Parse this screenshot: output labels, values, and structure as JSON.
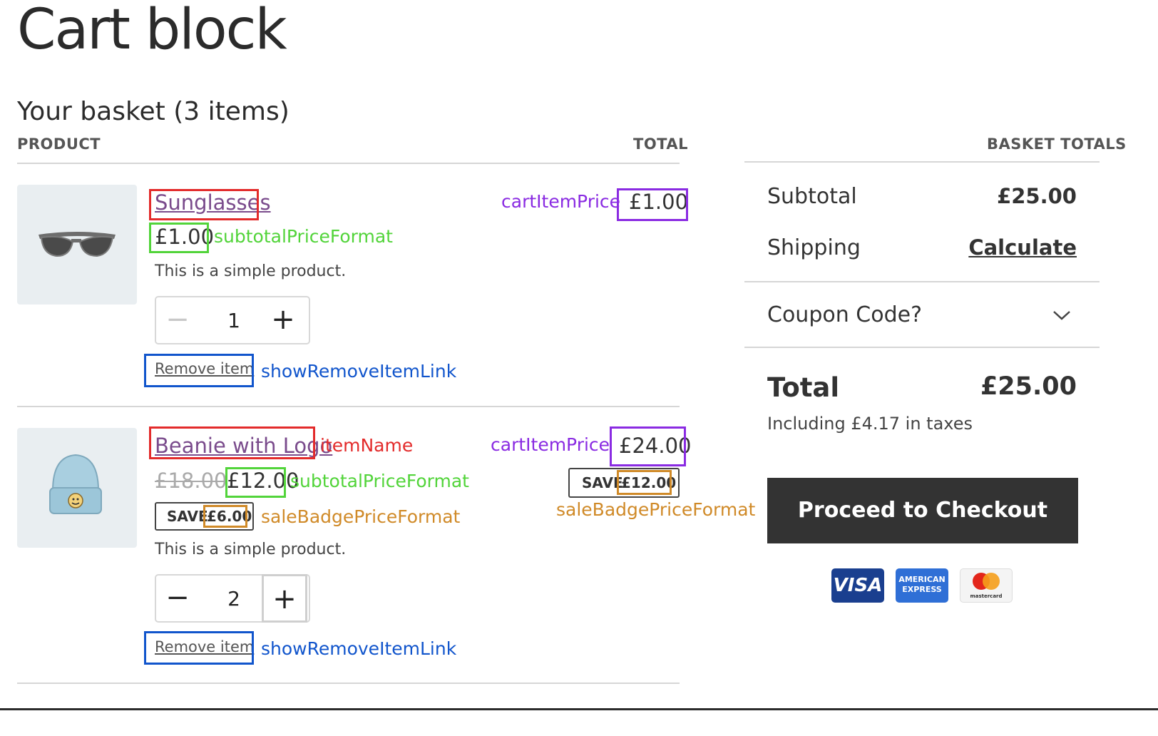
{
  "page": {
    "title": "Cart block",
    "basket_heading": "Your basket (3 items)"
  },
  "columns": {
    "product": "PRODUCT",
    "total": "TOTAL",
    "basket_totals": "BASKET TOTALS"
  },
  "items": [
    {
      "name": "Sunglasses",
      "unit_price": "£1.00",
      "description": "This is a simple product.",
      "quantity": "1",
      "remove_label": "Remove item",
      "line_total": "£1.00",
      "thumb_icon": "sunglasses-icon"
    },
    {
      "name": "Beanie with Logo",
      "regular_price": "£18.00",
      "unit_price": "£12.00",
      "sale_badge_label": "SAVE",
      "sale_badge_amount": "£6.00",
      "description": "This is a simple product.",
      "quantity": "2",
      "remove_label": "Remove item",
      "line_total": "£24.00",
      "line_sale_badge_label": "SAVE",
      "line_sale_badge_amount": "£12.00",
      "thumb_icon": "beanie-icon"
    }
  ],
  "annotations": {
    "item_name": "itemName",
    "subtotal_price_format": "subtotalPriceFormat",
    "cart_item_price": "cartItemPrice",
    "show_remove_item_link": "showRemoveItemLink",
    "sale_badge_price_format": "saleBadgePriceFormat",
    "colors": {
      "red": "#e32b2b",
      "green": "#52d43a",
      "purple": "#8a2be2",
      "blue": "#1155cc",
      "orange": "#d08a28"
    }
  },
  "totals": {
    "subtotal_label": "Subtotal",
    "subtotal_value": "£25.00",
    "shipping_label": "Shipping",
    "shipping_action": "Calculate",
    "coupon_label": "Coupon Code?",
    "total_label": "Total",
    "total_value": "£25.00",
    "tax_note": "Including £4.17 in taxes",
    "checkout_label": "Proceed to Checkout"
  },
  "payment_methods": [
    {
      "name": "VISA",
      "icon": "visa-card-icon"
    },
    {
      "name": "AMERICAN EXPRESS",
      "line1": "AMERICAN",
      "line2": "EXPRESS",
      "icon": "amex-card-icon"
    },
    {
      "name": "mastercard",
      "icon": "mastercard-icon"
    }
  ]
}
